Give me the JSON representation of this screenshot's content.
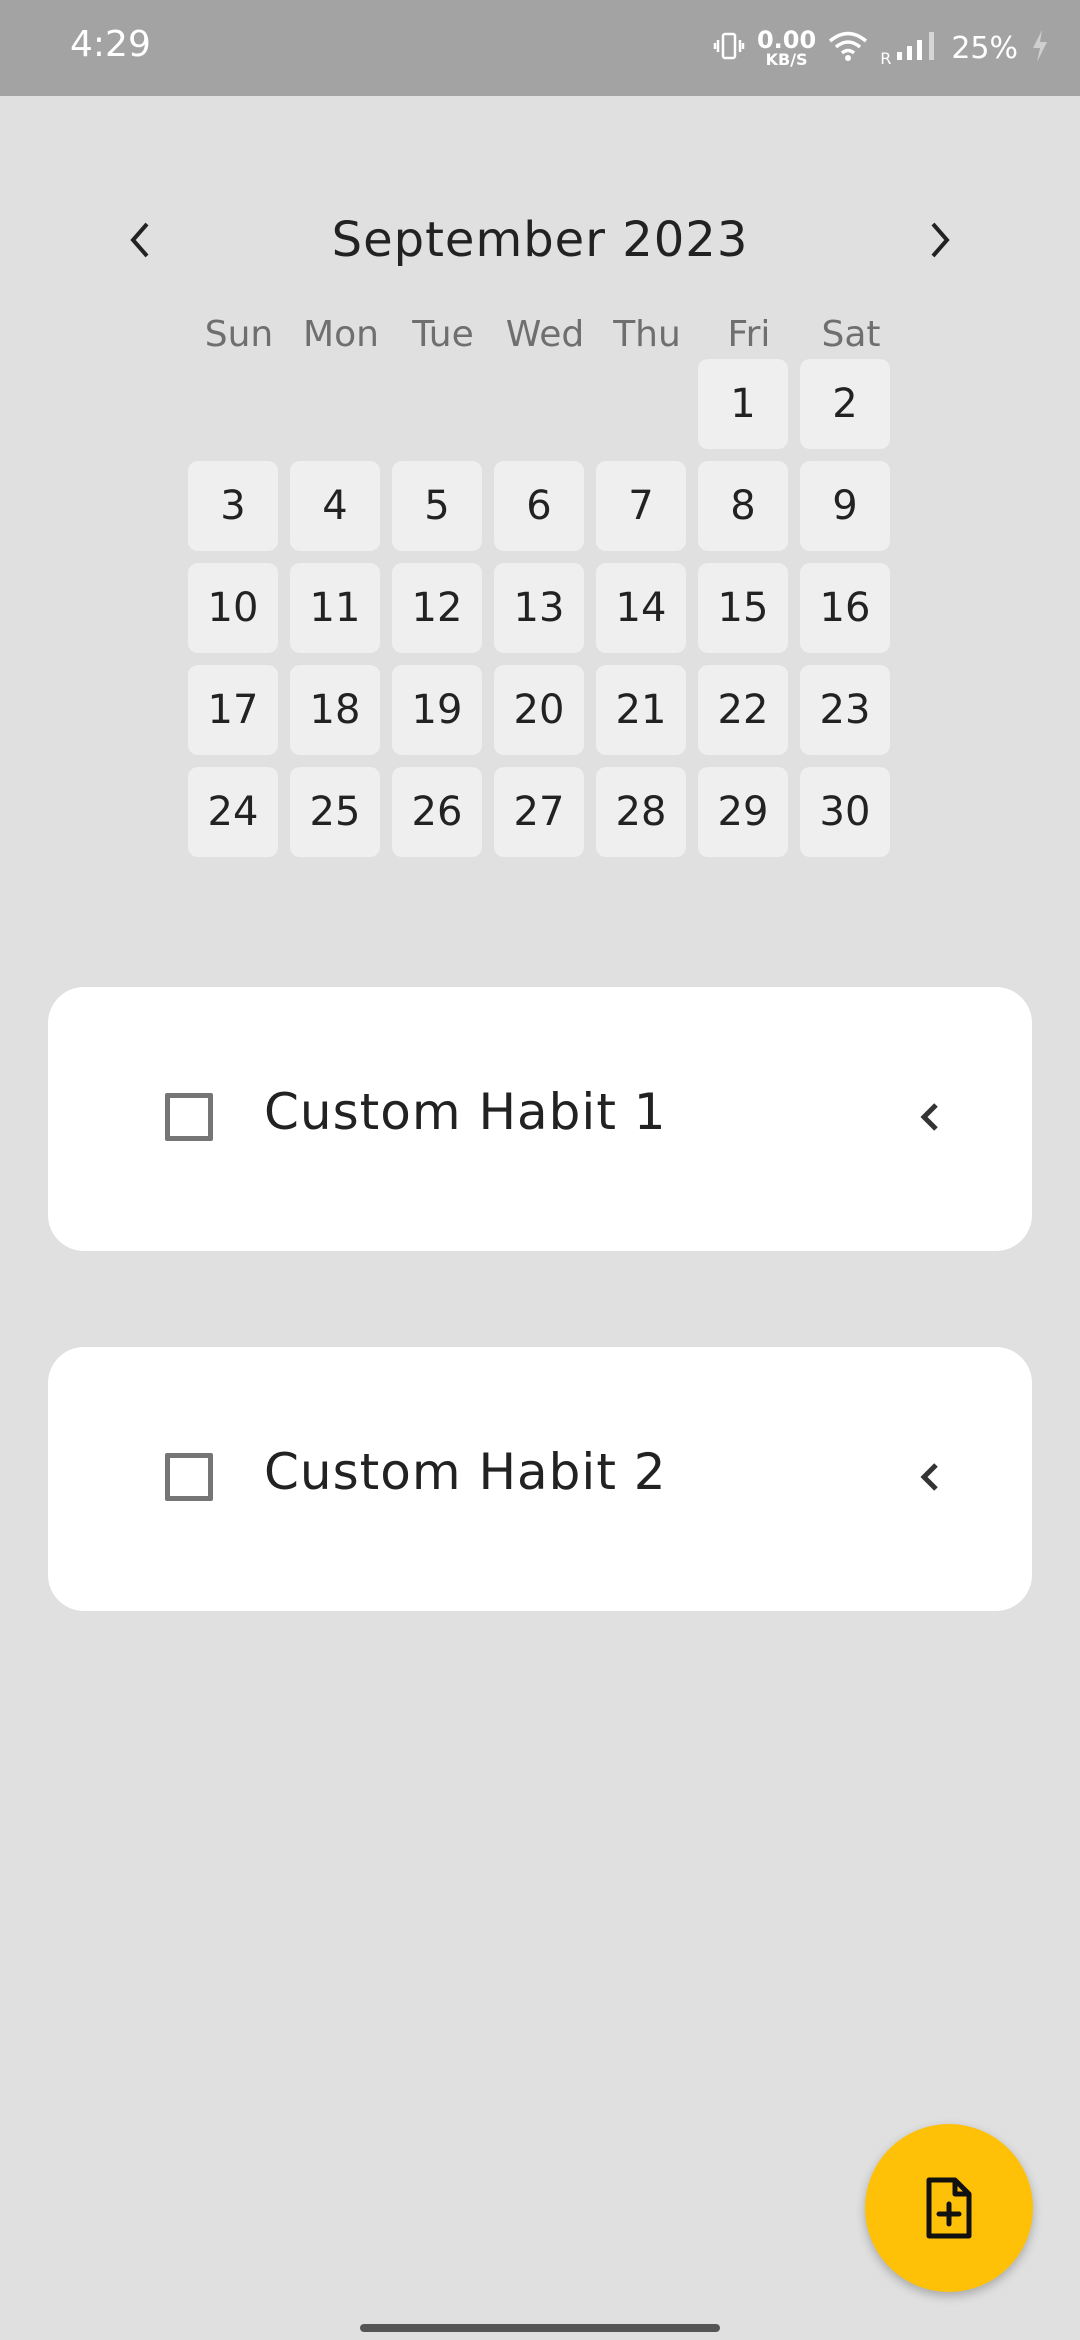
{
  "status_bar": {
    "time": "4:29",
    "net_speed_value": "0.00",
    "net_speed_unit": "KB/S",
    "roaming": "R",
    "battery": "25%"
  },
  "calendar": {
    "month_title": "September 2023",
    "weekdays": [
      "Sun",
      "Mon",
      "Tue",
      "Wed",
      "Thu",
      "Fri",
      "Sat"
    ],
    "days": [
      "1",
      "2",
      "3",
      "4",
      "5",
      "6",
      "7",
      "8",
      "9",
      "10",
      "11",
      "12",
      "13",
      "14",
      "15",
      "16",
      "17",
      "18",
      "19",
      "20",
      "21",
      "22",
      "23",
      "24",
      "25",
      "26",
      "27",
      "28",
      "29",
      "30"
    ]
  },
  "habits": [
    {
      "label": "Custom Habit 1",
      "checked": false
    },
    {
      "label": "Custom Habit 2",
      "checked": false
    }
  ],
  "icons": {
    "prev": "chevron-left-icon",
    "next": "chevron-right-icon",
    "expand": "chevron-left-icon",
    "fab": "file-plus-icon"
  }
}
